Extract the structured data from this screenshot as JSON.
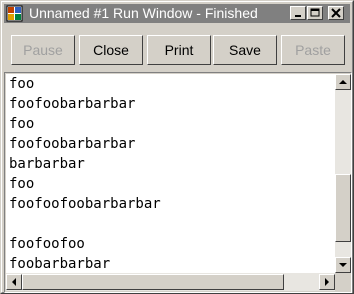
{
  "window": {
    "title": "Unnamed #1 Run Window - Finished"
  },
  "toolbar": {
    "pause_label": "Pause",
    "close_label": "Close",
    "print_label": "Print",
    "save_label": "Save",
    "paste_label": "Paste"
  },
  "output": {
    "lines": [
      "foo",
      "foofoobarbarbar",
      "foo",
      "foofoobarbarbar",
      "barbarbar",
      "foo",
      "foofoofoobarbarbar",
      "",
      "foofoofoo",
      "foobarbarbar"
    ]
  },
  "colors": {
    "titlebar_inactive": "#808080",
    "face": "#d4d0c8",
    "disabled_text": "#a0a0a0"
  },
  "icons": {
    "app": "app-icon",
    "minimize": "minimize-icon",
    "maximize": "maximize-icon",
    "close": "close-icon",
    "scroll_up": "arrow-up-icon",
    "scroll_down": "arrow-down-icon",
    "scroll_left": "arrow-left-icon",
    "scroll_right": "arrow-right-icon"
  }
}
